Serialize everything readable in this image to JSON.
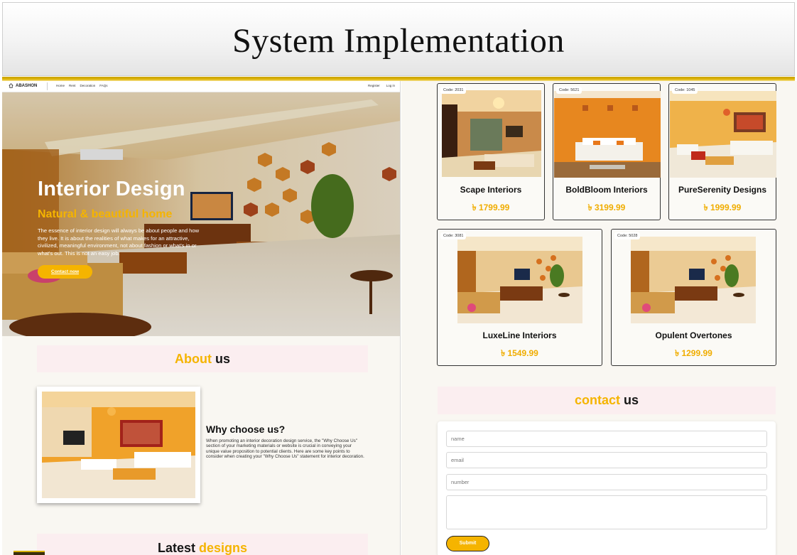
{
  "slide": {
    "title": "System Implementation"
  },
  "nav": {
    "brand": "ABASHON",
    "links": [
      "Home",
      "Rent",
      "Decoration",
      "FAQs"
    ],
    "right_links": [
      "Register",
      "Log in"
    ]
  },
  "hero": {
    "title": "Interior Design",
    "subtitle": "Natural & beautiful home",
    "text": "The essence of interior design will always be about people and how they live. It is about the realities of what makes for an attractive, civilized, meaningful environment, not about fashion or what's in or what's out. This is not an easy job.",
    "button": "Contact now"
  },
  "about": {
    "heading_accent": "About",
    "heading_rest": " us",
    "why_title": "Why choose us?",
    "why_text": "When promoting an interior decoration design service, the \"Why Choose Us\" section of your marketing materials or website is crucial in conveying your unique value proposition to potential clients. Here are some key points to consider when creating your \"Why Choose Us\" statement for interior decoration."
  },
  "latest": {
    "heading_rest": "Latest ",
    "heading_accent": "designs"
  },
  "designs": [
    {
      "code": "Code: 2031",
      "name": "Scape Interiors",
      "price": "৳ 1799.99"
    },
    {
      "code": "Code: 5621",
      "name": "BoldBloom Interiors",
      "price": "৳ 3199.99"
    },
    {
      "code": "Code: 1045",
      "name": "PureSerenity Designs",
      "price": "৳ 1999.99"
    },
    {
      "code": "Code: 3081",
      "name": "LuxeLine Interiors",
      "price": "৳ 1549.99"
    },
    {
      "code": "Code: 5028",
      "name": "Opulent Overtones",
      "price": "৳ 1299.99"
    }
  ],
  "contact": {
    "heading_accent": "contact",
    "heading_rest": " us",
    "name_placeholder": "name",
    "email_placeholder": "email",
    "number_placeholder": "number",
    "submit": "Submit"
  },
  "colors": {
    "accent": "#f5b400",
    "band": "#fbeef0",
    "gold_line": "#d8b000"
  }
}
